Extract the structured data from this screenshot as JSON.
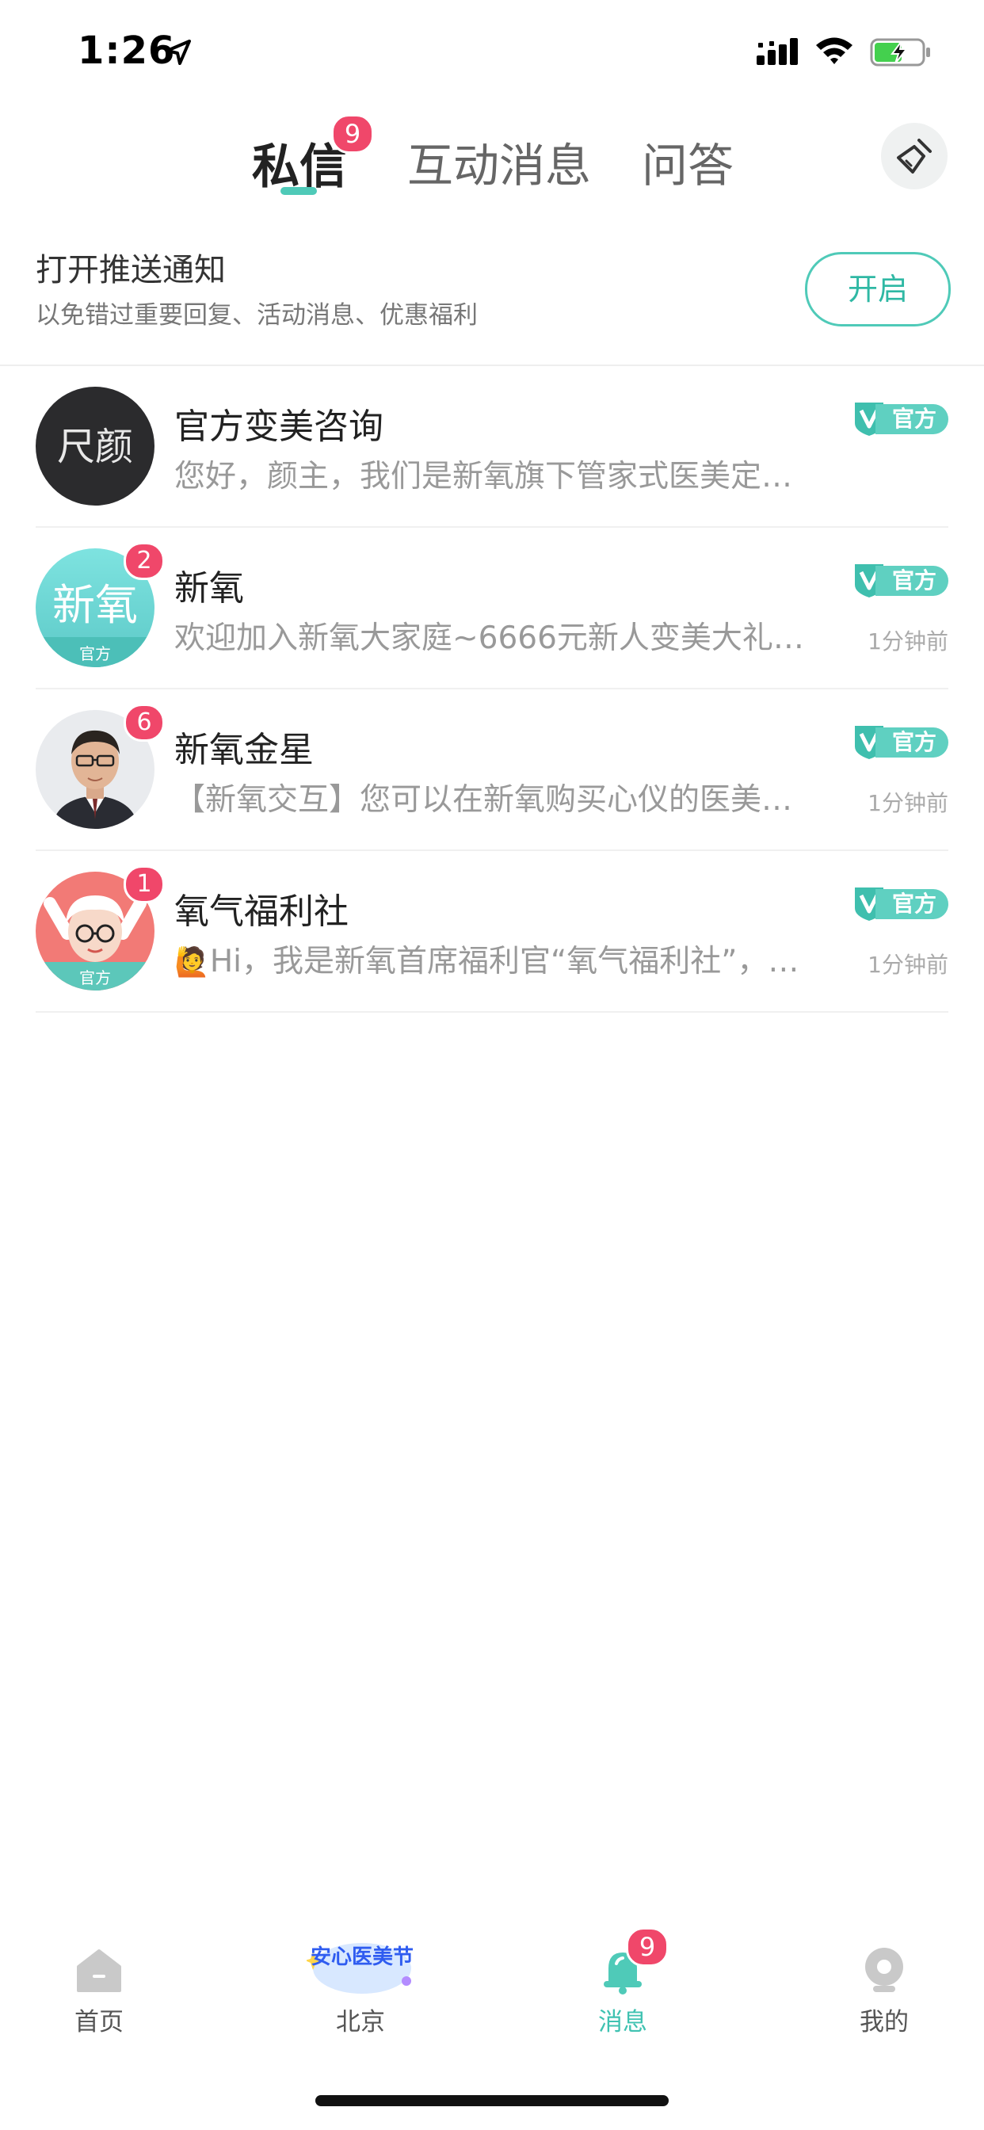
{
  "status_bar": {
    "time": "1:26"
  },
  "tabs": {
    "private": "私信",
    "interact": "互动消息",
    "qa": "问答",
    "private_badge": "9"
  },
  "push_notice": {
    "title": "打开推送通知",
    "subtitle": "以免错过重要回复、活动消息、优惠福利",
    "button": "开启"
  },
  "official_tag": "官方",
  "conversations": [
    {
      "name": "官方变美咨询",
      "preview": "您好，颜主，我们是新氧旗下管家式医美定…",
      "time": "",
      "badge": "",
      "avatar_text": "尺颜"
    },
    {
      "name": "新氧",
      "preview": "欢迎加入新氧大家庭~6666元新人变美大礼…",
      "time": "1分钟前",
      "badge": "2",
      "avatar_text": "新氧",
      "avatar_sub": "官方"
    },
    {
      "name": "新氧金星",
      "preview": "【新氧交互】您可以在新氧购买心仪的医美…",
      "time": "1分钟前",
      "badge": "6"
    },
    {
      "name": "氧气福利社",
      "preview_emoji": "🙋",
      "preview": "Hi，我是新氧首席福利官“氧气福利社”，…",
      "time": "1分钟前",
      "badge": "1",
      "avatar_sub": "官方"
    }
  ],
  "bottom_nav": {
    "home": "首页",
    "city": "北京",
    "city_banner": "安心医美节",
    "message": "消息",
    "message_badge": "9",
    "mine": "我的"
  },
  "colors": {
    "accent": "#4fcab8",
    "badge": "#f0476a",
    "official": "#5fd0c1"
  }
}
